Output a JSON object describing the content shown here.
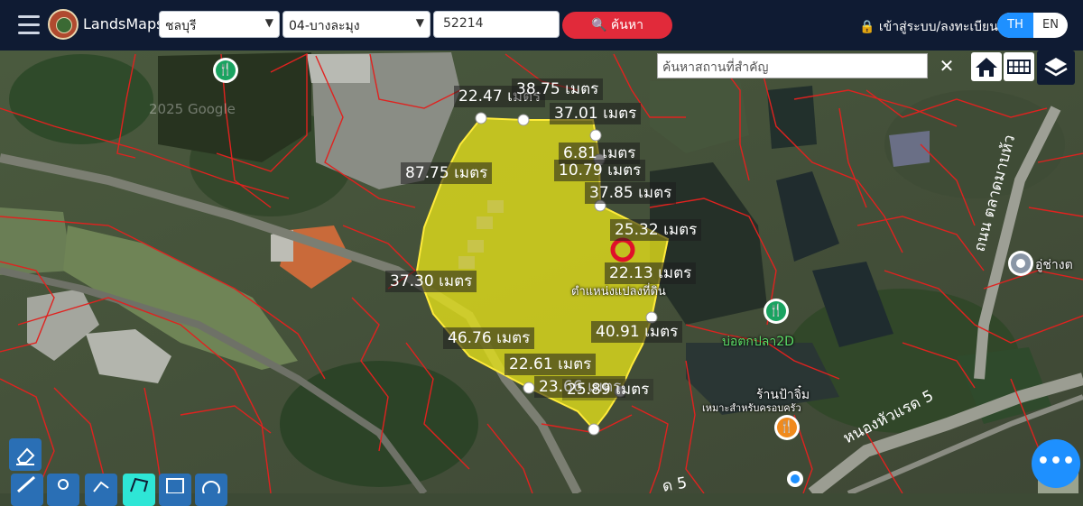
{
  "header": {
    "brand": "LandsMaps",
    "province": "ชลบุรี",
    "district": "04-บางละมุง",
    "parcel_number": "52214",
    "search_label": "ค้นหา",
    "login_label": "เข้าสู่ระบบ/ลงทะเบียน",
    "lang_th": "TH",
    "lang_en": "EN",
    "accent": "#1e90ff",
    "search_color": "#e12a3a"
  },
  "map": {
    "place_search_placeholder": "ค้นหาสถานที่สำคัญ",
    "watermark": "2025 Google",
    "measurements": [
      "22.47 เมตร",
      "38.75 เมตร",
      "37.01 เมตร",
      "6.81 เมตร",
      "10.79 เมตร",
      "87.75 เมตร",
      "37.85 เมตร",
      "25.32 เมตร",
      "22.13 เมตร",
      "37.30 เมตร",
      "40.91 เมตร",
      "46.76 เมตร",
      "22.61 เมตร",
      "23.66 เมตร",
      "25.89 เมตร"
    ],
    "parcel_location_label": "ตำแหน่งแปลงที่ดิน",
    "pois": {
      "fish_pond": "บ่อตกปลา2D",
      "restaurant": "ร้านป้าจิ๋ม",
      "restaurant_sub": "เหมาะสำหรับครอบครัว",
      "garage": "อู่ช่างต",
      "road_1": "ถนน ตลาดมาบห้ว",
      "road_2": "หนองหัวแรด 5",
      "road_3": "ด 5"
    },
    "parcel_fill": "#e6e11a"
  },
  "toolbar": {
    "tools": [
      "eraser-icon",
      "ruler-icon",
      "pin-icon",
      "line-icon",
      "polygon-icon",
      "rectangle-icon",
      "circle-icon"
    ]
  }
}
